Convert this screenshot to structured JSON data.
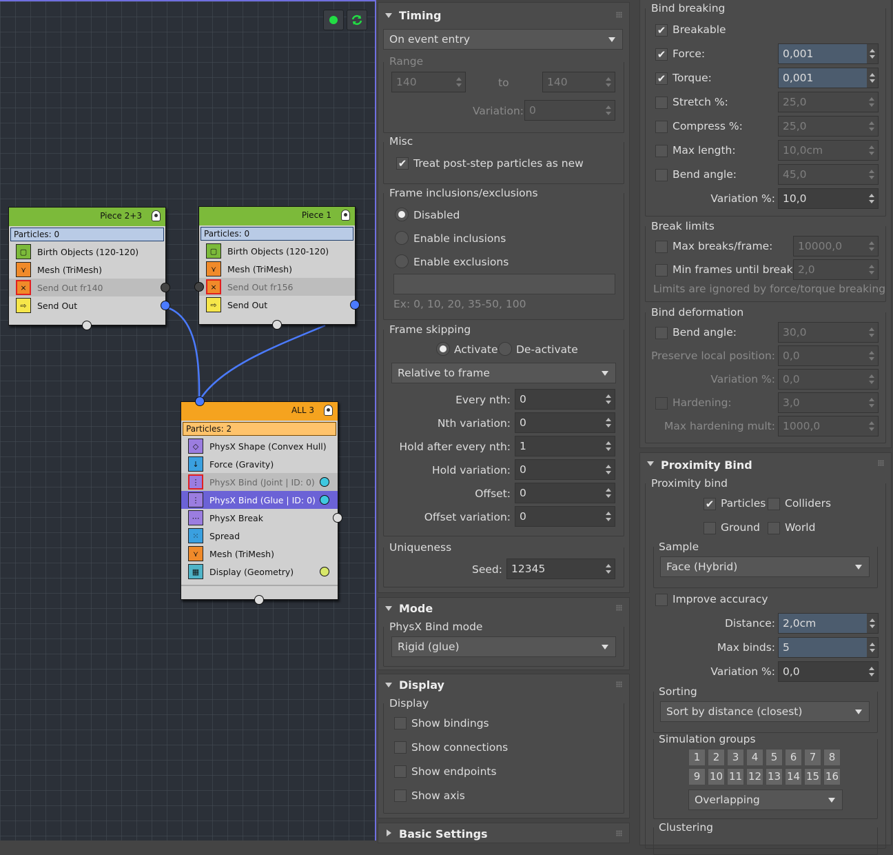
{
  "graph": {
    "toolbar": [
      {
        "icon": "green-dot-icon",
        "color": "#22dd44"
      },
      {
        "icon": "refresh-icon",
        "color": "#22dd44"
      }
    ],
    "nodes": [
      {
        "title": "Piece 2+3",
        "color": "#7cba3a",
        "particles": "Particles: 0",
        "ops": [
          {
            "label": "Birth Objects (120-120)",
            "icon": "birth-icon"
          },
          {
            "label": "Mesh (TriMesh)",
            "icon": "mesh-icon"
          },
          {
            "label": "Send Out fr140",
            "icon": "send-out-disabled-icon"
          },
          {
            "label": "Send Out",
            "icon": "send-out-icon"
          }
        ]
      },
      {
        "title": "Piece 1",
        "color": "#7cba3a",
        "particles": "Particles: 0",
        "ops": [
          {
            "label": "Birth Objects (120-120)",
            "icon": "birth-icon"
          },
          {
            "label": "Mesh (TriMesh)",
            "icon": "mesh-icon"
          },
          {
            "label": "Send Out fr156",
            "icon": "send-out-disabled-icon"
          },
          {
            "label": "Send Out",
            "icon": "send-out-icon"
          }
        ]
      },
      {
        "title": "ALL 3",
        "color": "#f5a31f",
        "particles": "Particles: 2",
        "ops": [
          {
            "label": "PhysX Shape (Convex Hull)",
            "icon": "physx-shape-icon"
          },
          {
            "label": "Force (Gravity)",
            "icon": "force-icon"
          },
          {
            "label": "PhysX Bind (Joint | ID: 0)",
            "icon": "physx-bind-joint-icon"
          },
          {
            "label": "PhysX Bind (Glue | ID: 0)",
            "icon": "physx-bind-glue-icon"
          },
          {
            "label": "PhysX Break",
            "icon": "physx-break-icon"
          },
          {
            "label": "Spread",
            "icon": "spread-icon"
          },
          {
            "label": "Mesh (TriMesh)",
            "icon": "mesh-icon"
          },
          {
            "label": "Display (Geometry)",
            "icon": "display-icon"
          }
        ]
      }
    ]
  },
  "timing": {
    "title": "Timing",
    "event": "On event entry",
    "range": {
      "label": "Range",
      "from": "140",
      "to_label": "to",
      "to": "140",
      "variation_label": "Variation:",
      "variation": "0"
    },
    "misc": {
      "label": "Misc",
      "treat_label": "Treat post-step particles as new"
    },
    "frame_incl": {
      "label": "Frame inclusions/exclusions",
      "options": [
        "Disabled",
        "Enable inclusions",
        "Enable exclusions"
      ],
      "hint": "Ex: 0, 10, 20, 35-50, 100"
    },
    "frame_skip": {
      "label": "Frame skipping",
      "activate": "Activate",
      "deactivate": "De-activate",
      "mode": "Relative to frame",
      "fields": [
        {
          "label": "Every nth:",
          "value": "0"
        },
        {
          "label": "Nth variation:",
          "value": "0"
        },
        {
          "label": "Hold after every nth:",
          "value": "1"
        },
        {
          "label": "Hold variation:",
          "value": "0"
        },
        {
          "label": "Offset:",
          "value": "0"
        },
        {
          "label": "Offset variation:",
          "value": "0"
        }
      ]
    },
    "uniq": {
      "label": "Uniqueness",
      "seed_label": "Seed:",
      "seed": "12345"
    }
  },
  "mode": {
    "title": "Mode",
    "group": "PhysX Bind mode",
    "value": "Rigid (glue)"
  },
  "display": {
    "title": "Display",
    "group": "Display",
    "items": [
      "Show bindings",
      "Show connections",
      "Show endpoints",
      "Show axis"
    ]
  },
  "basic": {
    "title": "Basic Settings"
  },
  "bind_break": {
    "label": "Bind breaking",
    "breakable": "Breakable",
    "rows": [
      {
        "label": "Force:",
        "value": "0,001",
        "checked": true
      },
      {
        "label": "Torque:",
        "value": "0,001",
        "checked": true
      },
      {
        "label": "Stretch %:",
        "value": "25,0",
        "checked": false
      },
      {
        "label": "Compress %:",
        "value": "25,0",
        "checked": false
      },
      {
        "label": "Max length:",
        "value": "10,0cm",
        "checked": false
      },
      {
        "label": "Bend angle:",
        "value": "45,0",
        "checked": false
      }
    ],
    "variation_label": "Variation %:",
    "variation": "10,0"
  },
  "break_limits": {
    "label": "Break limits",
    "rows": [
      {
        "label": "Max breaks/frame:",
        "value": "10000,0"
      },
      {
        "label": "Min frames until break:",
        "value": "2,0"
      }
    ],
    "note": "Limits are ignored by force/torque breaking"
  },
  "bind_deform": {
    "label": "Bind deformation",
    "bend_label": "Bend angle:",
    "bend": "30,0",
    "preserve_label": "Preserve local position:",
    "preserve": "0,0",
    "variation_label": "Variation %:",
    "variation": "0,0",
    "hardening_label": "Hardening:",
    "hardening": "3,0",
    "maxhard_label": "Max hardening mult:",
    "maxhard": "1000,0"
  },
  "prox": {
    "title": "Proximity Bind",
    "group": "Proximity bind",
    "particles": "Particles",
    "colliders": "Colliders",
    "ground": "Ground",
    "world": "World",
    "sample_label": "Sample",
    "sample": "Face (Hybrid)",
    "improve": "Improve accuracy",
    "distance_label": "Distance:",
    "distance": "2,0cm",
    "maxbinds_label": "Max binds:",
    "maxbinds": "5",
    "variation_label": "Variation %:",
    "variation": "0,0",
    "sorting_label": "Sorting",
    "sorting": "Sort by distance (closest)",
    "simgroups_label": "Simulation groups",
    "groups": [
      "1",
      "2",
      "3",
      "4",
      "5",
      "6",
      "7",
      "8",
      "9",
      "10",
      "11",
      "12",
      "13",
      "14",
      "15",
      "16"
    ],
    "overlap": "Overlapping",
    "clustering_label": "Clustering"
  }
}
